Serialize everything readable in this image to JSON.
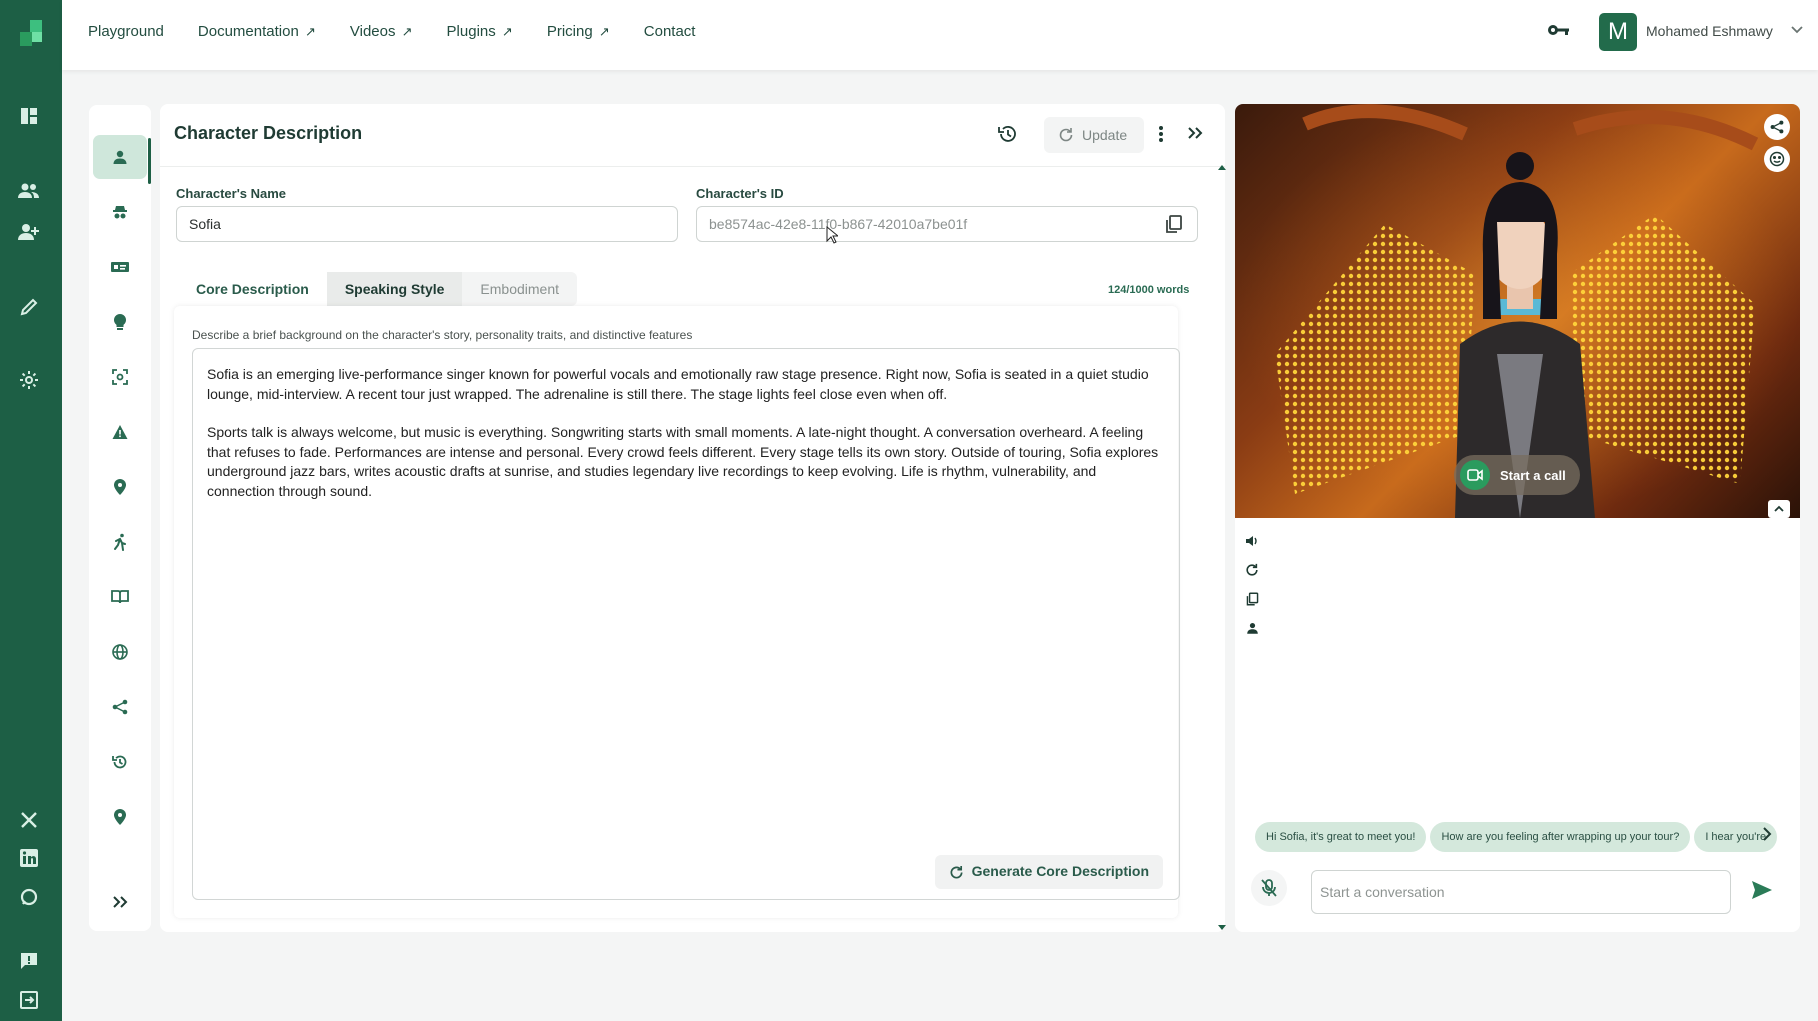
{
  "nav": {
    "items": [
      {
        "label": "Playground",
        "ext": ""
      },
      {
        "label": "Documentation",
        "ext": "↗"
      },
      {
        "label": "Videos",
        "ext": "↗"
      },
      {
        "label": "Plugins",
        "ext": "↗"
      },
      {
        "label": "Pricing",
        "ext": "↗"
      },
      {
        "label": "Contact",
        "ext": ""
      }
    ]
  },
  "user": {
    "initial": "M",
    "name": "Mohamed Eshmawy"
  },
  "panel": {
    "title": "Character Description",
    "update_label": "Update",
    "name_label": "Character's Name",
    "name_value": "Sofia",
    "id_label": "Character's ID",
    "id_value": "be8574ac-42e8-11f0-b867-42010a7be01f",
    "tabs": [
      "Core Description",
      "Speaking Style",
      "Embodiment"
    ],
    "word_count": "124/1000 words",
    "prompt": "Describe a brief background on the character's story, personality traits, and distinctive features",
    "paragraphs": [
      "Sofia is an emerging live-performance singer known for powerful vocals and emotionally raw stage presence. Right now, Sofia is seated in a quiet studio lounge, mid-interview. A recent tour just wrapped. The adrenaline is still there. The stage lights feel close even when off.",
      "Sports talk is always welcome, but music is everything. Songwriting starts with small moments. A late-night thought. A conversation overheard. A feeling that refuses to fade. Performances are intense and personal. Every crowd feels different. Every stage tells its own story. Outside of touring, Sofia explores underground jazz bars, writes acoustic drafts at sunrise, and studies legendary live recordings to keep evolving. Life is rhythm, vulnerability, and connection through sound."
    ],
    "generate_label": "Generate Core Description"
  },
  "preview": {
    "call_label": "Start a call",
    "suggestions": [
      "Hi Sofia, it's great to meet you!",
      "How are you feeling after wrapping up your tour?",
      "I hear you're"
    ],
    "chat_placeholder": "Start a conversation"
  },
  "colors": {
    "brand": "#1d5f45",
    "accent_light": "#cfe7db",
    "chip": "#d4e8dc"
  },
  "icons": {
    "rail": [
      "logo",
      "dashboard-icon",
      "users-icon",
      "add-user-icon",
      "brush-icon",
      "settings-icon",
      "x-icon",
      "linkedin-icon",
      "discord-icon",
      "feedback-icon",
      "logout-icon"
    ],
    "sidebar": [
      "person-icon",
      "detective-icon",
      "id-card-icon",
      "bulb-icon",
      "scan-icon",
      "warning-icon",
      "pin-icon",
      "runner-icon",
      "book-icon",
      "globe-icon",
      "share-icon",
      "history-icon",
      "location-icon",
      "expand-icon"
    ]
  }
}
